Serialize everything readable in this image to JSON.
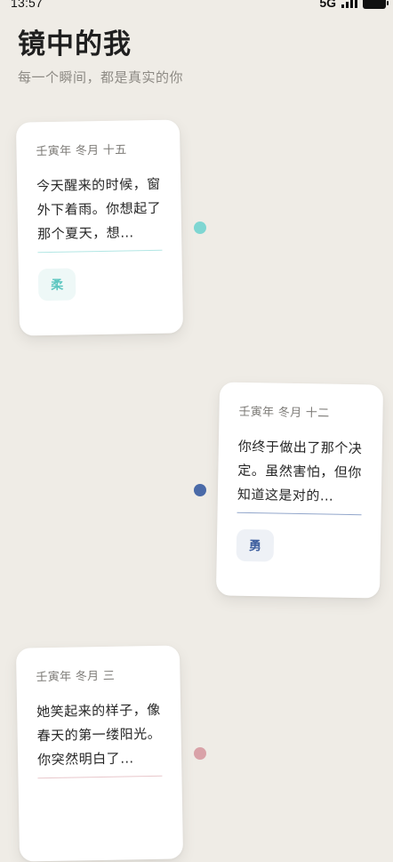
{
  "status_bar": {
    "time": "13:57",
    "network": "5G"
  },
  "header": {
    "title": "镜中的我",
    "subtitle": "每一个瞬间，都是真实的你"
  },
  "entries": [
    {
      "date": "壬寅年 冬月 十五",
      "text": "今天醒来的时候，窗外下着雨。你想起了那个夏天，想…",
      "tag": "柔",
      "accent": "#7fd6d2",
      "tag_bg": "#eef8f7",
      "tag_color": "#5cc6c0"
    },
    {
      "date": "壬寅年 冬月 十二",
      "text": "你终于做出了那个决定。虽然害怕，但你知道这是对的…",
      "tag": "勇",
      "accent": "#4a6aa8",
      "tag_bg": "#eef1f6",
      "tag_color": "#3d5e9e"
    },
    {
      "date": "壬寅年 冬月 三",
      "text": "她笑起来的样子，像春天的第一缕阳光。你突然明白了…",
      "tag": "",
      "accent": "#d9a2a8",
      "tag_bg": "#f8eeef",
      "tag_color": "#c97b84"
    }
  ]
}
